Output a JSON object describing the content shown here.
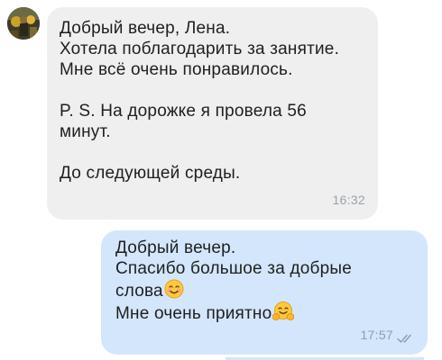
{
  "incoming": {
    "lines": [
      "Добрый вечер, Лена.",
      "Хотела поблагодарить за занятие.",
      "Мне всё очень понравилось.",
      "P. S. На дорожке я провела 56",
      "минут.",
      "До следующей среды."
    ],
    "time": "16:32",
    "avatar_icon": "user-avatar-photo"
  },
  "outgoing": {
    "lines": [
      "Добрый вечер.",
      "Спасибо большое за добрые",
      "слова",
      "Мне очень приятно"
    ],
    "emojis": [
      "smiling-face-icon",
      "hugging-face-icon"
    ],
    "time": "17:57",
    "status_icon": "double-check-icon",
    "status_color": "#8d9db0"
  },
  "colors": {
    "incoming_bubble": "#efefef",
    "outgoing_bubble": "#d3e6fb",
    "text": "#1f1f1f",
    "timestamp": "#9aa3ad"
  }
}
